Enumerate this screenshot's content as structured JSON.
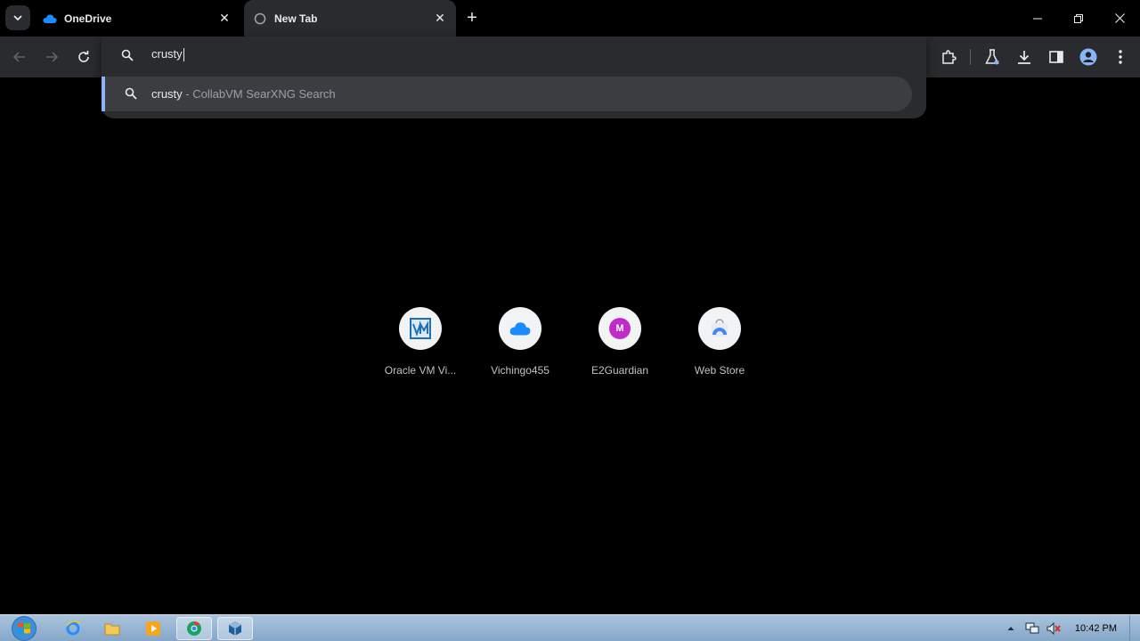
{
  "tabs": [
    {
      "title": "OneDrive",
      "icon": "onedrive-cloud-icon",
      "active": false
    },
    {
      "title": "New Tab",
      "icon": "loading-globe-icon",
      "active": true
    }
  ],
  "window_controls": {
    "minimize": "minimize-icon",
    "restore": "restore-icon",
    "close": "close-icon"
  },
  "omnibox": {
    "value": "crusty",
    "suggestion": {
      "query": "crusty",
      "separator": " - ",
      "engine": "CollabVM SearXNG Search"
    }
  },
  "shortcuts": [
    {
      "label": "Oracle VM Vi...",
      "icon": "virtualbox-icon"
    },
    {
      "label": "Vichingo455",
      "icon": "onedrive-cloud-icon"
    },
    {
      "label": "E2Guardian",
      "icon": "letter-m-icon",
      "letter": "M"
    },
    {
      "label": "Web Store",
      "icon": "web-store-icon"
    }
  ],
  "taskbar": {
    "clock": "10:42 PM",
    "items": [
      "internet-explorer-icon",
      "file-explorer-icon",
      "media-player-icon",
      "chrome-icon",
      "virtualbox-icon"
    ]
  },
  "colors": {
    "accent": "#8ab4f8",
    "toolbar": "#2a2b2e",
    "suggestion_bg": "#3c3d40",
    "m_badge": "#c02cc7"
  }
}
